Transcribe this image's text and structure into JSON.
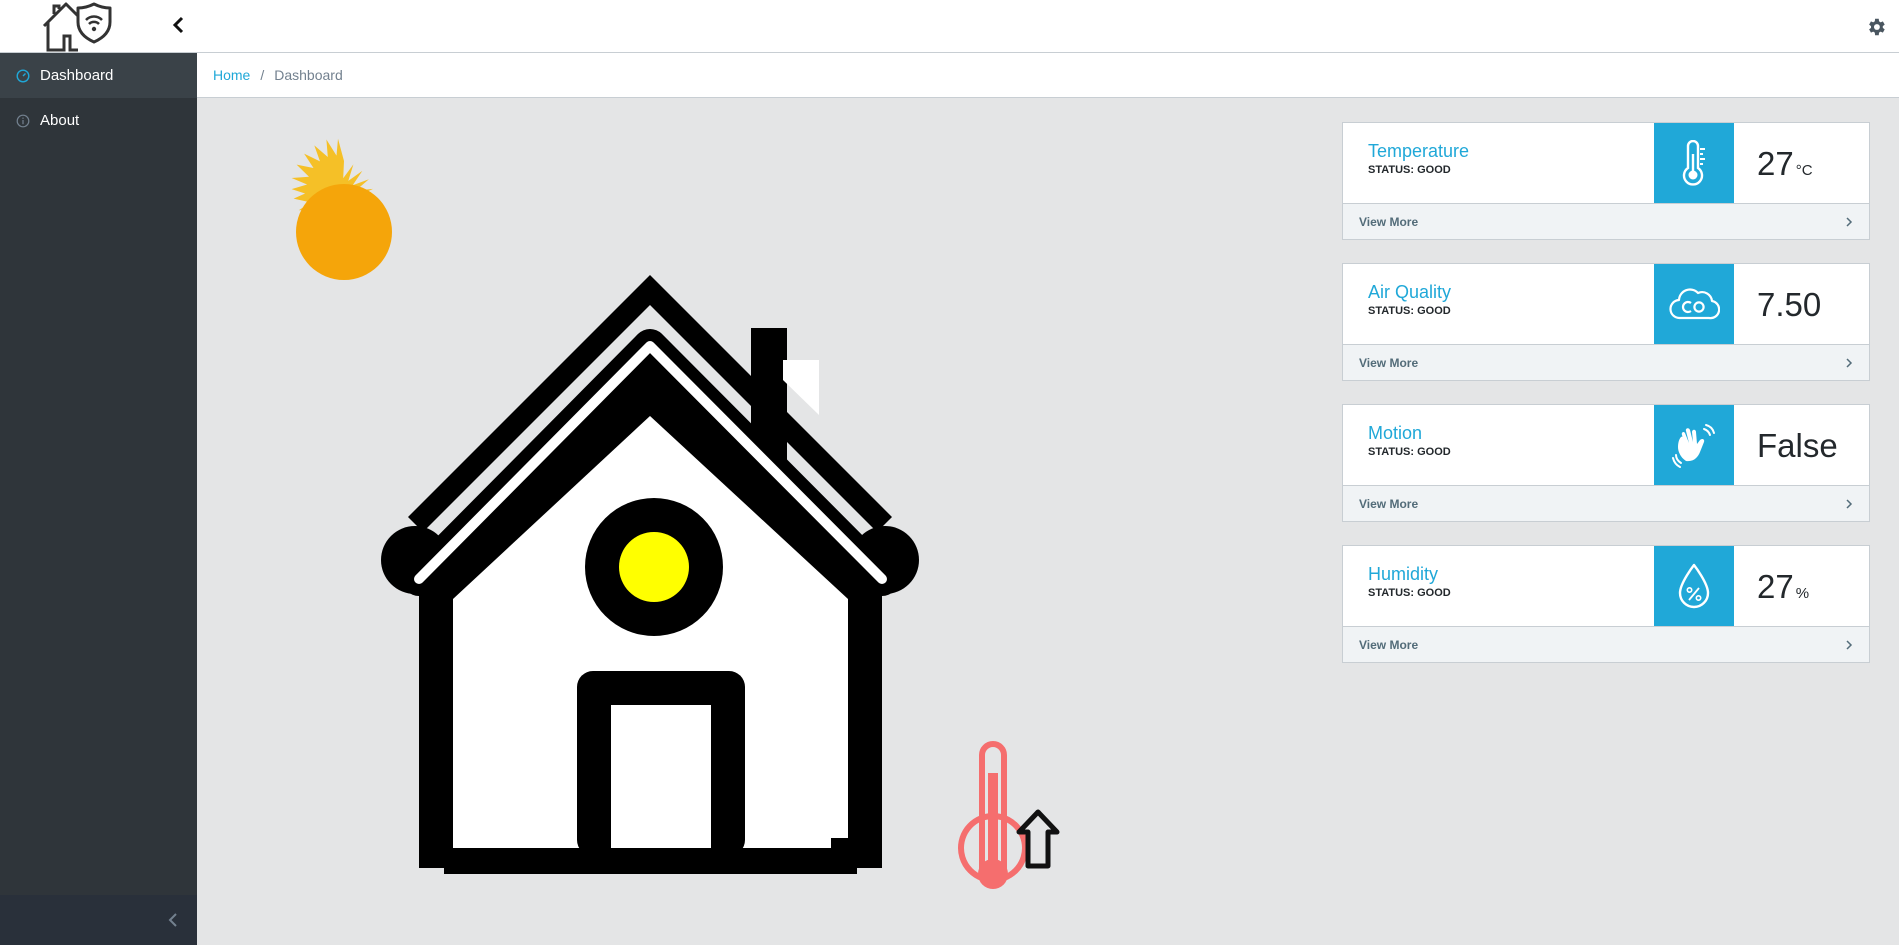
{
  "nav": {
    "items": [
      {
        "label": "Dashboard",
        "icon": "speedometer-icon",
        "active": true
      },
      {
        "label": "About",
        "icon": "info-icon",
        "active": false
      }
    ]
  },
  "breadcrumb": {
    "home": "Home",
    "current": "Dashboard"
  },
  "cards": [
    {
      "title": "Temperature",
      "status": "STATUS: GOOD",
      "value": "27",
      "unit": "°C",
      "icon": "thermometer-icon",
      "footer": "View More"
    },
    {
      "title": "Air Quality",
      "status": "STATUS: GOOD",
      "value": "7.50",
      "unit": "",
      "icon": "co-cloud-icon",
      "footer": "View More"
    },
    {
      "title": "Motion",
      "status": "STATUS: GOOD",
      "value": "False",
      "unit": "",
      "icon": "waving-hand-icon",
      "footer": "View More"
    },
    {
      "title": "Humidity",
      "status": "STATUS: GOOD",
      "value": "27",
      "unit": "%",
      "icon": "humidity-drop-icon",
      "footer": "View More"
    }
  ],
  "colors": {
    "accent": "#20a8d8",
    "sidebar": "#2f353a",
    "sun": "#f5a50a",
    "window_light": "#ffff00",
    "thermometer": "#f56e6e"
  }
}
